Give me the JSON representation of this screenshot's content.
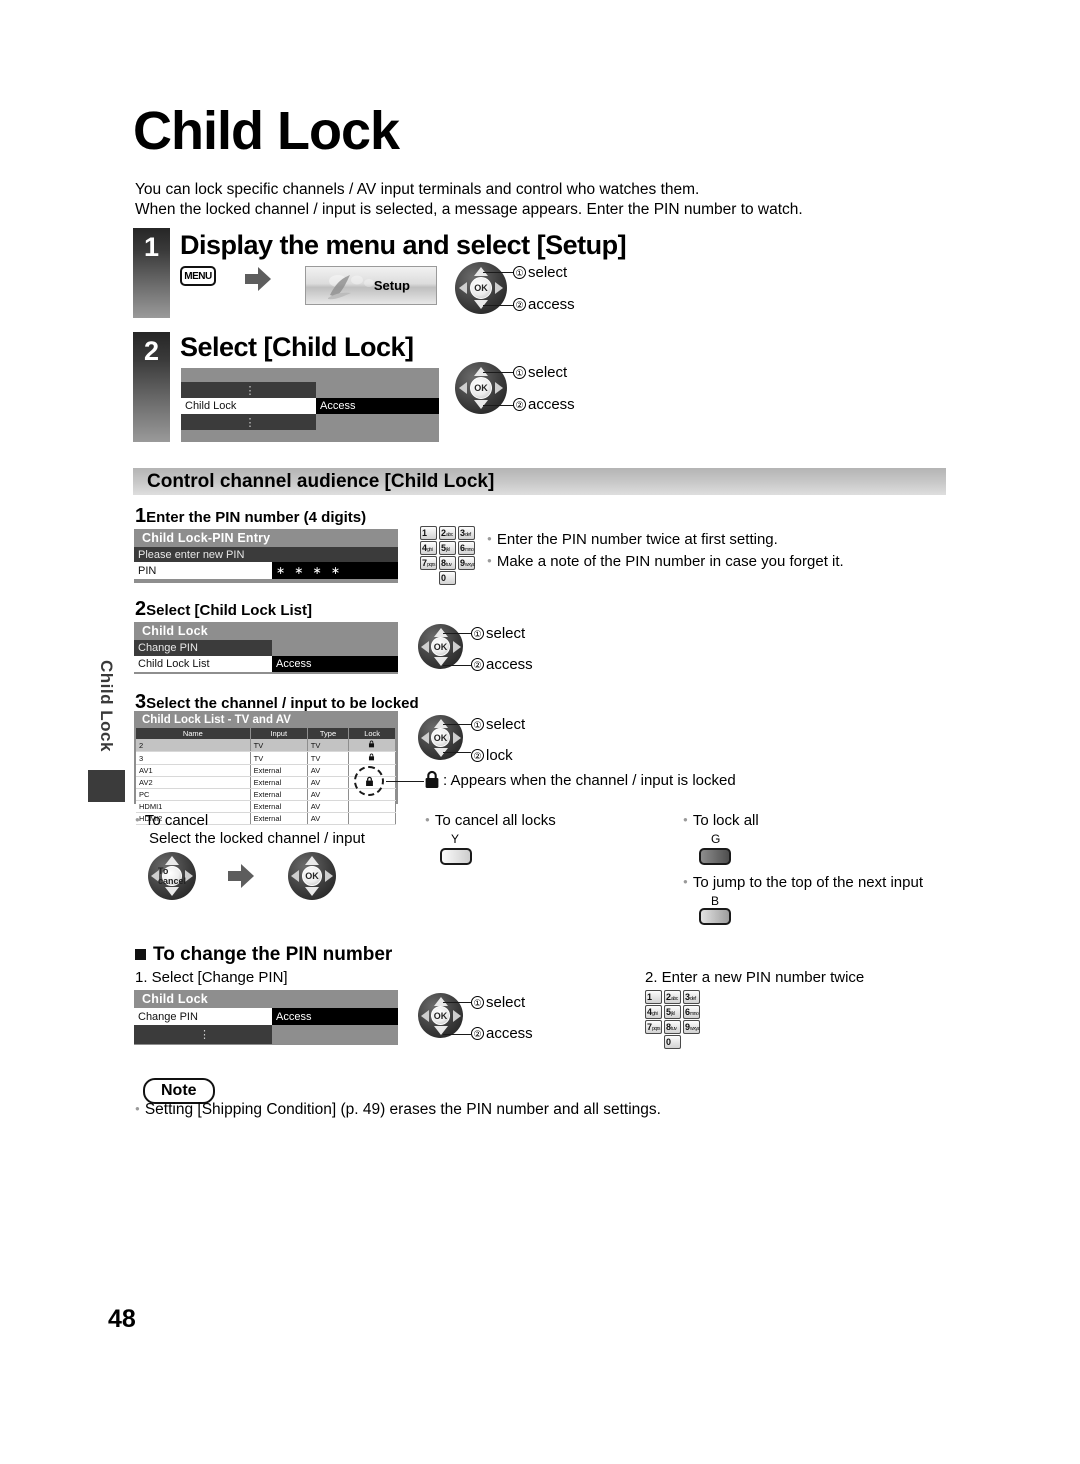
{
  "page": {
    "title": "Child Lock",
    "number": "48",
    "side_tab": "Child Lock",
    "intro_line1": "You can lock specific channels / AV input terminals and control who watches them.",
    "intro_line2": "When the locked channel / input is selected, a message appears. Enter the PIN number to watch."
  },
  "steps": [
    {
      "num": "1",
      "heading": "Display the menu and select [Setup]"
    },
    {
      "num": "2",
      "heading": "Select [Child Lock]"
    }
  ],
  "step1": {
    "menu_key": "MENU",
    "setup_banner_label": "Setup",
    "pad": {
      "ok": "OK",
      "action1": "select",
      "action2": "access",
      "mark1": "①",
      "mark2": "②"
    }
  },
  "step2": {
    "menu_rows": [
      {
        "label": "⋮",
        "value": "",
        "state": "dark-dots"
      },
      {
        "label": "Child Lock",
        "value": "Access",
        "state": "selected"
      },
      {
        "label": "⋮",
        "value": "",
        "state": "dark-dots"
      }
    ],
    "pad": {
      "ok": "OK",
      "action1": "select",
      "action2": "access",
      "mark1": "①",
      "mark2": "②"
    }
  },
  "section": {
    "heading": "Control channel audience [Child Lock]"
  },
  "sub1": {
    "num": "1",
    "heading": "Enter the PIN number (4 digits)",
    "osd_title": "Child Lock-PIN Entry",
    "osd_prompt": "Please enter new PIN",
    "field_label": "PIN",
    "field_value": "∗ ∗ ∗ ∗",
    "notes": [
      "Enter the PIN number twice at first setting.",
      "Make a note of the PIN number in case you forget it."
    ]
  },
  "keypad": {
    "keys": [
      {
        "digit": "1",
        "letters": ""
      },
      {
        "digit": "2",
        "letters": "abc"
      },
      {
        "digit": "3",
        "letters": "def"
      },
      {
        "digit": "4",
        "letters": "ghi"
      },
      {
        "digit": "5",
        "letters": "jkl"
      },
      {
        "digit": "6",
        "letters": "mno"
      },
      {
        "digit": "7",
        "letters": "pqrs"
      },
      {
        "digit": "8",
        "letters": "tuv"
      },
      {
        "digit": "9",
        "letters": "wxyz"
      },
      {
        "digit": "0",
        "letters": ""
      }
    ]
  },
  "sub2": {
    "num": "2",
    "heading": "Select [Child Lock List]",
    "osd_title": "Child Lock",
    "rows": [
      {
        "label": "Change PIN",
        "value": "",
        "state": "dark"
      },
      {
        "label": "Child Lock List",
        "value": "Access",
        "state": "selected"
      }
    ],
    "pad": {
      "ok": "OK",
      "action1": "select",
      "action2": "access",
      "mark1": "①",
      "mark2": "②"
    }
  },
  "sub3": {
    "num": "3",
    "heading": "Select the channel / input to be locked",
    "list_title": "Child Lock List - TV and AV",
    "columns": [
      "Name",
      "Input",
      "Type",
      "Lock"
    ],
    "rows": [
      {
        "name": "2",
        "input": "TV",
        "type": "TV",
        "lock": "🔒",
        "highlight": true
      },
      {
        "name": "3",
        "input": "TV",
        "type": "TV",
        "lock": "🔒",
        "highlight": false
      },
      {
        "name": "AV1",
        "input": "External",
        "type": "AV",
        "lock": "",
        "highlight": false
      },
      {
        "name": "AV2",
        "input": "External",
        "type": "AV",
        "lock": "",
        "highlight": false
      },
      {
        "name": "PC",
        "input": "External",
        "type": "AV",
        "lock": "",
        "highlight": false
      },
      {
        "name": "HDMI1",
        "input": "External",
        "type": "AV",
        "lock": "",
        "highlight": false
      },
      {
        "name": "HDMI2",
        "input": "External",
        "type": "AV",
        "lock": "",
        "highlight": false
      }
    ],
    "pad": {
      "ok": "OK",
      "action1": "select",
      "action2": "lock",
      "mark1": "①",
      "mark2": "②"
    },
    "lock_legend": ": Appears when the channel / input is locked"
  },
  "actions": {
    "cancel_title": "To cancel",
    "cancel_sub": "Select the locked channel / input",
    "cancel_all": "To cancel all locks",
    "cancel_all_key": "Y",
    "lock_all": "To lock all",
    "lock_all_key": "G",
    "jump_next": "To jump to the top of the next input",
    "jump_next_key": "B"
  },
  "change_pin": {
    "heading": "To change the PIN number",
    "item1": "1. Select [Change PIN]",
    "item2": "2. Enter a new PIN number twice",
    "osd_title": "Child Lock",
    "rows": [
      {
        "label": "Change PIN",
        "value": "Access",
        "state": "selected"
      },
      {
        "label": "⋮",
        "value": "",
        "state": "dark-dots"
      }
    ],
    "pad": {
      "ok": "OK",
      "action1": "select",
      "action2": "access",
      "mark1": "①",
      "mark2": "②"
    }
  },
  "note": {
    "label": "Note",
    "text": "Setting [Shipping Condition] (p. 49) erases the PIN number and all settings."
  },
  "colors": {
    "osd_bg": "#8e8e8e",
    "osd_row_dark": "#3b3b3b",
    "selected_value_bg": "#000000",
    "section_header": "#c9c9c9"
  }
}
